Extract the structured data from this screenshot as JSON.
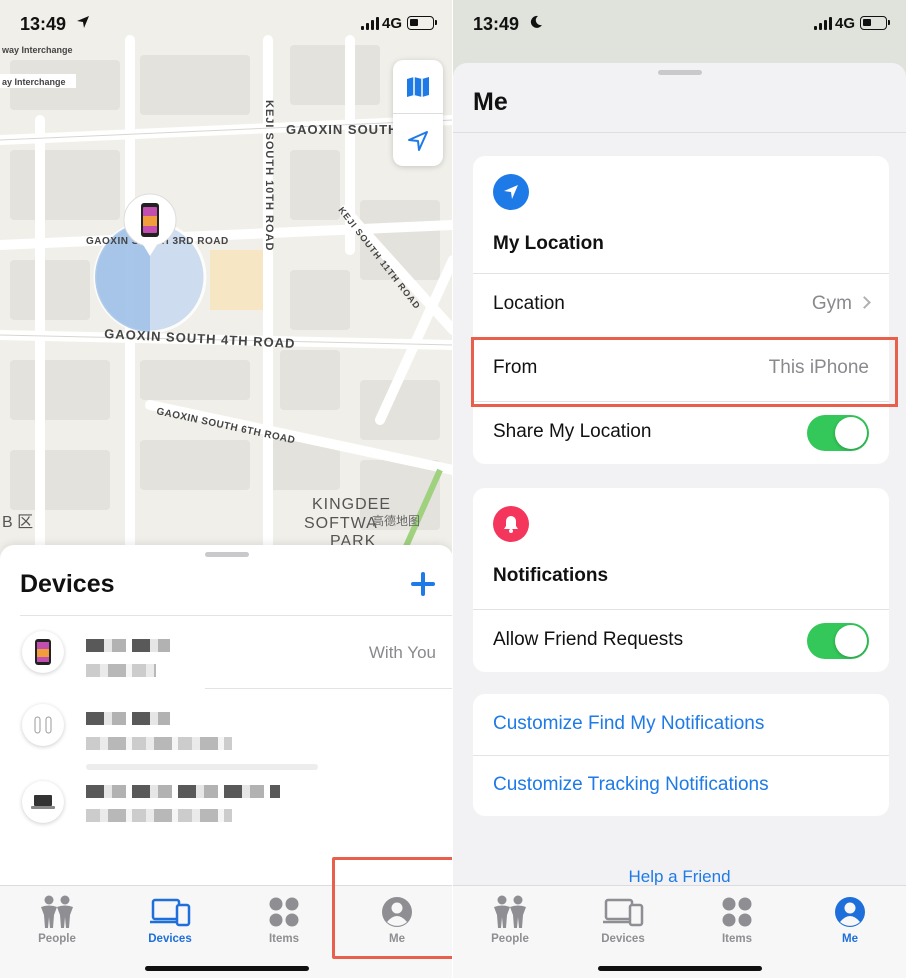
{
  "left": {
    "status": {
      "time": "13:49",
      "network": "4G"
    },
    "map": {
      "labels": {
        "freeway1": "way Interchange",
        "freeway2": "ay Interchange",
        "keji_10th": "KEJI SOUTH 10TH ROAD",
        "gaoxin_s1": "GAOXIN SOUTH",
        "gaoxin_3rd": "GAOXIN SOUTH 3RD ROAD",
        "keji_11th": "KEJI SOUTH 11TH ROAD",
        "gaoxin_4th": "GAOXIN SOUTH 4TH ROAD",
        "gaoxin_6th": "GAOXIN SOUTH 6TH ROAD",
        "kingdee1": "KINGDEE",
        "kingdee2": "SOFTWA",
        "kingdee3": "PARK",
        "district": "B 区",
        "attribution": "高德地图"
      }
    },
    "devices": {
      "title": "Devices",
      "first_status": "With You"
    },
    "tabs": [
      {
        "label": "People",
        "icon": "people-icon"
      },
      {
        "label": "Devices",
        "icon": "devices-icon"
      },
      {
        "label": "Items",
        "icon": "items-icon"
      },
      {
        "label": "Me",
        "icon": "me-icon"
      }
    ],
    "active_tab": "Devices"
  },
  "right": {
    "status": {
      "time": "13:49",
      "network": "4G"
    },
    "title": "Me",
    "my_location": {
      "heading": "My Location",
      "location_label": "Location",
      "location_value": "Gym",
      "from_label": "From",
      "from_value": "This iPhone",
      "share_label": "Share My Location",
      "share_on": true
    },
    "notifications": {
      "heading": "Notifications",
      "allow_label": "Allow Friend Requests",
      "allow_on": true
    },
    "links": {
      "customize_find_my": "Customize Find My Notifications",
      "customize_tracking": "Customize Tracking Notifications"
    },
    "help": "Help a Friend",
    "tabs": [
      {
        "label": "People",
        "icon": "people-icon"
      },
      {
        "label": "Devices",
        "icon": "devices-icon"
      },
      {
        "label": "Items",
        "icon": "items-icon"
      },
      {
        "label": "Me",
        "icon": "me-icon"
      }
    ],
    "active_tab": "Me"
  },
  "colors": {
    "accent": "#1e7ae6",
    "toggle_on": "#34c759",
    "highlight": "#e8604c",
    "notification_icon": "#f5365c"
  }
}
